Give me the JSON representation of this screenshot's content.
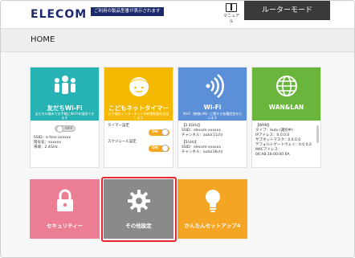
{
  "brand": {
    "logo": "ELECOM",
    "tagline": "ご利用の製品型番が表示されます"
  },
  "top": {
    "manual_label": "マニュアル",
    "router_mode": "ルーターモード"
  },
  "page": {
    "title": "HOME"
  },
  "cards": [
    {
      "title": "友だちWi-Fi",
      "desc": "友だちの端末でお手軽にWi-Fiを接続できます",
      "toggle_label": "OFF",
      "lines": [
        "SSID：e-fsns-xxxxxx",
        "暗号化：xxxxxx",
        "帯域：2.4GHz"
      ]
    },
    {
      "title": "こどもネットタイマー",
      "desc": "お子様のインターネットの時間制限を設定します",
      "timer_label": "タイマー設定",
      "timer_state": "ON",
      "schedule_label": "スケジュール設定",
      "schedule_state": "ON"
    },
    {
      "title": "Wi-Fi",
      "desc": "Wi-Fi（無線LAN）に関する各種設定を行います",
      "band1": "【2.4GHz】",
      "band1_lines": [
        "SSID：elecom-xxxxxx",
        "チャンネル：auto(11ch)"
      ],
      "band2": "【5GHz】",
      "band2_lines": [
        "SSID：elecom-xxxxxx",
        "チャンネル：auto(36ch)"
      ]
    },
    {
      "title": "WAN&LAN",
      "wan_label": "【WAN】",
      "lines": [
        "タイプ：Auto (識別中)",
        "IPアドレス：0.0.0.0",
        "サブネットマスク：0.0.0.0",
        "デフォルトゲートウェイ：0.0.0.0",
        "MACアドレス：",
        "04:AB:18:00:00:6A"
      ]
    }
  ],
  "tiles": [
    {
      "label": "セキュリティー"
    },
    {
      "label": "その他設定"
    },
    {
      "label": "かんたんセットアップ4"
    }
  ],
  "colors": {
    "teal": "#27b3b3",
    "yellow": "#f5b800",
    "blue": "#5b8fd8",
    "green": "#6ab53c",
    "pink": "#eb7e93",
    "gray": "#8a8a8a",
    "orange": "#f4a523",
    "highlight": "#e8262e"
  }
}
